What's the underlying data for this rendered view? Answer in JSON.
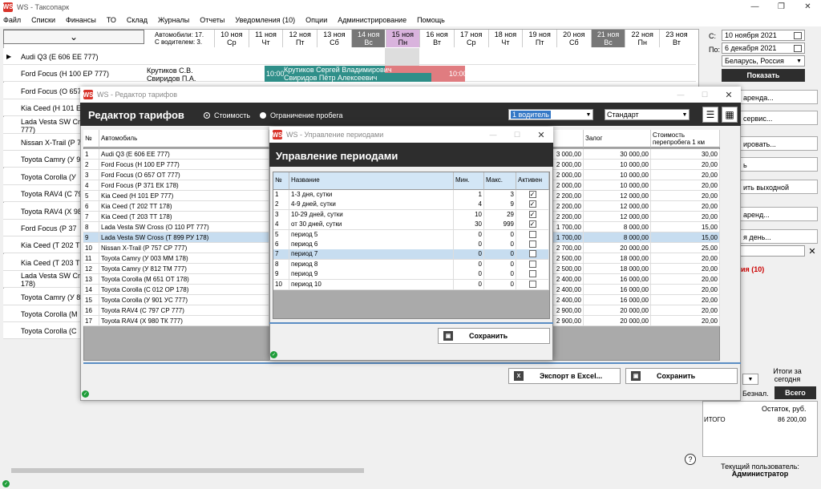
{
  "app": {
    "title": "WS - Таксопарк",
    "logo": "WS"
  },
  "menu": [
    "Файл",
    "Списки",
    "Финансы",
    "ТО",
    "Склад",
    "Журналы",
    "Отчеты",
    "Уведомления (10)",
    "Опции",
    "Администрирование",
    "Помощь"
  ],
  "schedule": {
    "cars_count": "Автомобили: 17.",
    "drivers_count": "С водителем: 3.",
    "days": [
      {
        "d": "10 ноя",
        "w": "Ср",
        "t": ""
      },
      {
        "d": "11 ноя",
        "w": "Чт",
        "t": ""
      },
      {
        "d": "12 ноя",
        "w": "Пт",
        "t": ""
      },
      {
        "d": "13 ноя",
        "w": "Сб",
        "t": ""
      },
      {
        "d": "14 ноя",
        "w": "Вс",
        "t": "wk"
      },
      {
        "d": "15 ноя",
        "w": "Пн",
        "t": "tdy"
      },
      {
        "d": "16 ноя",
        "w": "Вт",
        "t": ""
      },
      {
        "d": "17 ноя",
        "w": "Ср",
        "t": ""
      },
      {
        "d": "18 ноя",
        "w": "Чт",
        "t": ""
      },
      {
        "d": "19 ноя",
        "w": "Пт",
        "t": ""
      },
      {
        "d": "20 ноя",
        "w": "Сб",
        "t": ""
      },
      {
        "d": "21 ноя",
        "w": "Вс",
        "t": "wk"
      },
      {
        "d": "22 ноя",
        "w": "Пн",
        "t": ""
      },
      {
        "d": "23 ноя",
        "w": "Вт",
        "t": ""
      }
    ],
    "vehicles": [
      "Audi Q3 (Е 606 ЕЕ 777)",
      "Ford Focus (Н 100 ЕР 777)",
      "Ford Focus (О 657",
      "Kia Ceed (Н 101 Е",
      "Lada Vesta SW Cr",
      "Nissan X-Trail (Р 7",
      "Toyota Camry (У 9",
      "Toyota Corolla (У",
      "Toyota RAV4 (С 79",
      "Toyota RAV4 (Х 98",
      "Ford Focus (Р 37",
      "Kia Ceed (Т 202 Т",
      "Kia Ceed (Т 203 Т",
      "Lada Vesta SW Cr",
      "Toyota Camry (У 8",
      "Toyota Corolla (М",
      "Toyota Corolla (С"
    ],
    "vehicles_wrap": {
      "4": "777)",
      "13": "178)"
    },
    "drivers": [
      "Крутиков С.В.",
      "Свиридов П.А."
    ],
    "booking": {
      "start": "10:00",
      "end": "10:00",
      "name1": "Крутиков Сергей Владимирович",
      "name2": "Свиридов Пётр Алексеевич"
    }
  },
  "right_panel": {
    "from_label": "С:",
    "from_date": "10 ноября 2021",
    "to_label": "По:",
    "to_date": "6 декабря 2021",
    "region": "Беларусь, Россия",
    "show": "Показать",
    "buttons": [
      "аренда...",
      "сервис...",
      "ировать...",
      "ь",
      "ить выходной",
      "аренд...",
      "я день..."
    ],
    "notice": "ия (10)",
    "totals_title": "Итоги за сегодня",
    "tab_cashless": "Безнал.",
    "tab_all": "Всего",
    "balance_header": "Остаток, руб.",
    "total_label": "ИТОГО",
    "total_value": "86 200,00",
    "user_label": "Текущий пользователь:",
    "user_name": "Администратор"
  },
  "tariff_editor": {
    "window_title": "WS - Редактор тарифов",
    "header": "Редактор тарифов",
    "radio_cost": "Стоимость",
    "radio_mileage": "Ограничение пробега",
    "drivers_select": "1 водитель",
    "plan_select": "Стандарт",
    "col_no": "№",
    "col_car": "Автомобиль",
    "col_deposit": "Залог",
    "col_overrun": "Стоимость перепробега 1 км",
    "rows": [
      [
        "1",
        "Audi Q3 (Е 606 ЕЕ 777)",
        "3 000,00",
        "30 000,00",
        "30,00"
      ],
      [
        "2",
        "Ford Focus (Н 100 ЕР 777)",
        "2 000,00",
        "10 000,00",
        "20,00"
      ],
      [
        "3",
        "Ford Focus (О 657 ОТ 777)",
        "2 000,00",
        "10 000,00",
        "20,00"
      ],
      [
        "4",
        "Ford Focus (Р 371 ЕК 178)",
        "2 000,00",
        "10 000,00",
        "20,00"
      ],
      [
        "5",
        "Kia Ceed (Н 101 ЕР 777)",
        "2 200,00",
        "12 000,00",
        "20,00"
      ],
      [
        "6",
        "Kia Ceed (Т 202 ТТ 178)",
        "2 200,00",
        "12 000,00",
        "20,00"
      ],
      [
        "7",
        "Kia Ceed (Т 203 ТТ 178)",
        "2 200,00",
        "12 000,00",
        "20,00"
      ],
      [
        "8",
        "Lada Vesta SW Cross (О 110 РТ 777)",
        "1 700,00",
        "8 000,00",
        "15,00"
      ],
      [
        "9",
        "Lada Vesta SW Cross (Т 899 РУ 178)",
        "1 700,00",
        "8 000,00",
        "15,00"
      ],
      [
        "10",
        "Nissan X-Trail (Р 757 СР 777)",
        "2 700,00",
        "20 000,00",
        "25,00"
      ],
      [
        "11",
        "Toyota Camry (У 003 ММ 178)",
        "2 500,00",
        "18 000,00",
        "20,00"
      ],
      [
        "12",
        "Toyota Camry (У 812 ТМ 777)",
        "2 500,00",
        "18 000,00",
        "20,00"
      ],
      [
        "13",
        "Toyota Corolla (М 651 ОТ 178)",
        "2 400,00",
        "16 000,00",
        "20,00"
      ],
      [
        "14",
        "Toyota Corolla (С 012 ОР 178)",
        "2 400,00",
        "16 000,00",
        "20,00"
      ],
      [
        "15",
        "Toyota Corolla (У 901 УС 777)",
        "2 400,00",
        "16 000,00",
        "20,00"
      ],
      [
        "16",
        "Toyota RAV4 (С 797 СР 777)",
        "2 900,00",
        "20 000,00",
        "20,00"
      ],
      [
        "17",
        "Toyota RAV4 (Х 980 ТК 777)",
        "2 900,00",
        "20 000,00",
        "20,00"
      ]
    ],
    "export": "Экспорт в Excel...",
    "save": "Сохранить"
  },
  "periods": {
    "window_title": "WS - Управление периодами",
    "header": "Управление периодами",
    "col_no": "№",
    "col_name": "Название",
    "col_min": "Мин.",
    "col_max": "Макс.",
    "col_active": "Активен",
    "rows": [
      [
        "1",
        "1-3 дня, сутки",
        "1",
        "3",
        true
      ],
      [
        "2",
        "4-9 дней, сутки",
        "4",
        "9",
        true
      ],
      [
        "3",
        "10-29 дней, сутки",
        "10",
        "29",
        true
      ],
      [
        "4",
        "от 30 дней, сутки",
        "30",
        "999",
        true
      ],
      [
        "5",
        "период 5",
        "0",
        "0",
        false
      ],
      [
        "6",
        "период 6",
        "0",
        "0",
        false
      ],
      [
        "7",
        "период 7",
        "0",
        "0",
        false
      ],
      [
        "8",
        "период 8",
        "0",
        "0",
        false
      ],
      [
        "9",
        "период 9",
        "0",
        "0",
        false
      ],
      [
        "10",
        "период 10",
        "0",
        "0",
        false
      ]
    ],
    "save": "Сохранить"
  },
  "colors": {
    "dark_header": "#2d2d2d",
    "booking_teal": "#2f8f89",
    "booking_red": "#e07c80",
    "weekend": "#777777",
    "today": "#d9b3dd",
    "selection": "#c7ddf0",
    "alert": "#cc0000"
  }
}
